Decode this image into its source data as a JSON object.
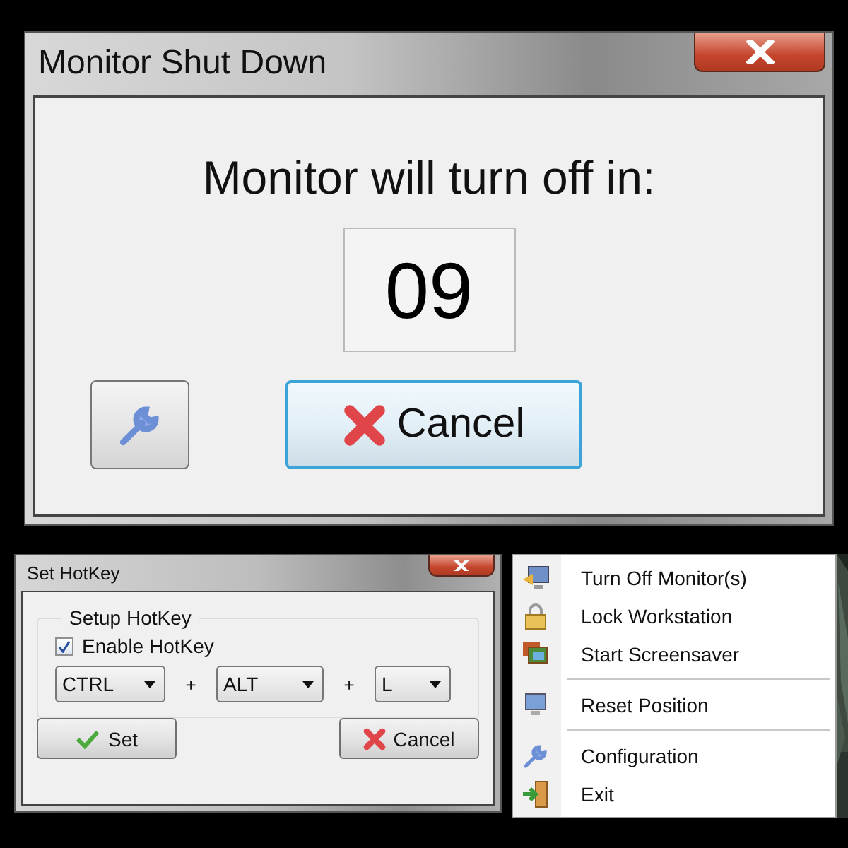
{
  "shutdown_window": {
    "title": "Monitor Shut Down",
    "message": "Monitor will turn off in:",
    "countdown": "09",
    "cancel_button": "Cancel"
  },
  "hotkey_window": {
    "title": "Set HotKey",
    "group_title": "Setup HotKey",
    "enable_checkbox": {
      "label": "Enable HotKey",
      "checked": true
    },
    "keys": [
      {
        "value": "CTRL"
      },
      {
        "value": "ALT"
      },
      {
        "value": "L"
      }
    ],
    "plus_signs": [
      "+",
      "+"
    ],
    "set_button": "Set",
    "cancel_button": "Cancel"
  },
  "tray_menu": {
    "groups": [
      [
        {
          "label": "Turn Off Monitor(s)"
        },
        {
          "label": "Lock Workstation"
        },
        {
          "label": "Start Screensaver"
        }
      ],
      [
        {
          "label": "Reset Position"
        }
      ],
      [
        {
          "label": "Configuration"
        },
        {
          "label": "Exit"
        }
      ]
    ]
  }
}
